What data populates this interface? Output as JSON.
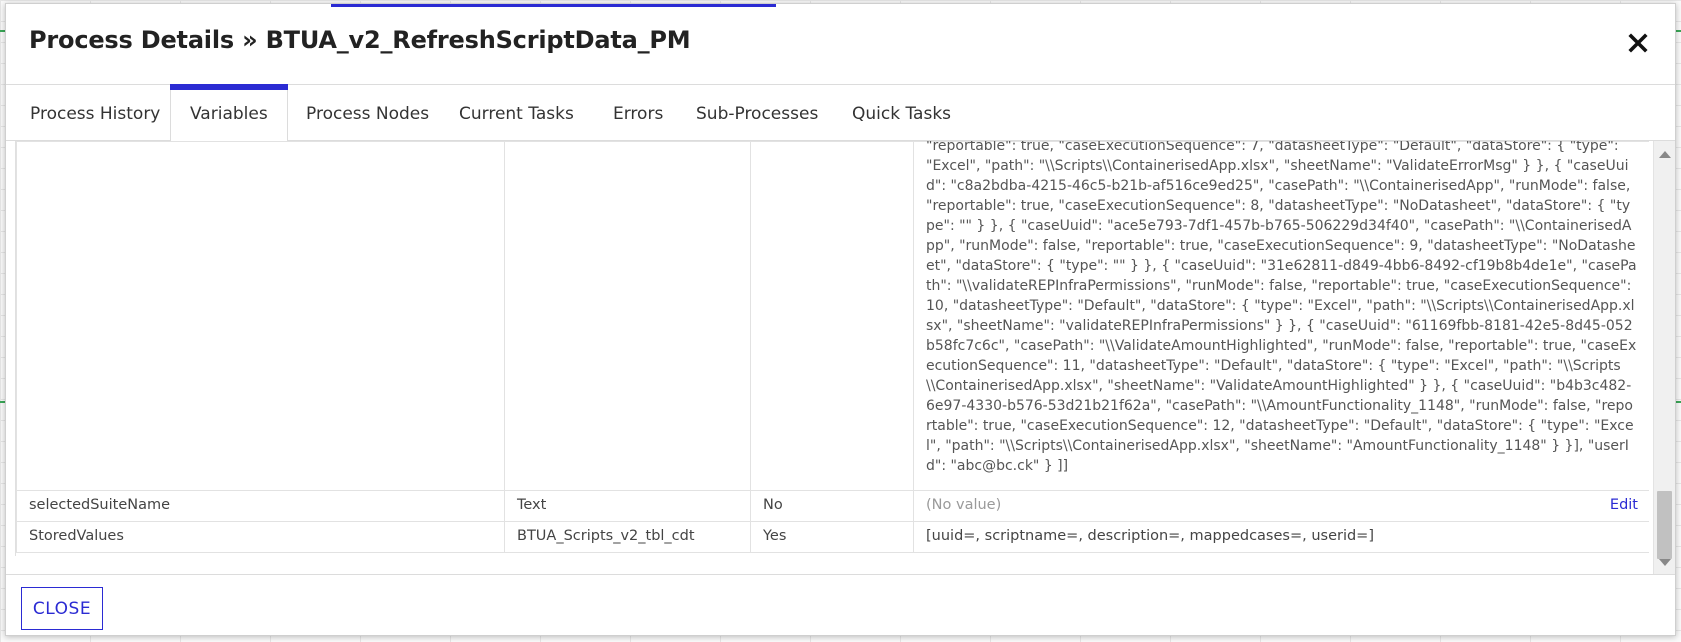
{
  "modal": {
    "title": "Process Details » BTUA_v2_RefreshScriptData_PM",
    "close_icon": "close-icon"
  },
  "tabs": [
    {
      "label": "Process History",
      "active": false
    },
    {
      "label": "Variables",
      "active": true
    },
    {
      "label": "Process Nodes",
      "active": false
    },
    {
      "label": "Current Tasks",
      "active": false
    },
    {
      "label": "Errors",
      "active": false
    },
    {
      "label": "Sub-Processes",
      "active": false
    },
    {
      "label": "Quick Tasks",
      "active": false
    }
  ],
  "variables": {
    "json_row": {
      "name": "",
      "type": "",
      "required": "",
      "value": "\"reportable\": true, \"caseExecutionSequence\": 7, \"datasheetType\": \"Default\", \"dataStore\": { \"type\": \"Excel\", \"path\": \"\\\\Scripts\\\\ContainerisedApp.xlsx\", \"sheetName\": \"ValidateErrorMsg\" } }, { \"caseUuid\": \"c8a2bdba-4215-46c5-b21b-af516ce9ed25\", \"casePath\": \"\\\\ContainerisedApp\", \"runMode\": false, \"reportable\": true, \"caseExecutionSequence\": 8, \"datasheetType\": \"NoDatasheet\", \"dataStore\": { \"type\": \"\" } }, { \"caseUuid\": \"ace5e793-7df1-457b-b765-506229d34f40\", \"casePath\": \"\\\\ContainerisedApp\", \"runMode\": false, \"reportable\": true, \"caseExecutionSequence\": 9, \"datasheetType\": \"NoDatasheet\", \"dataStore\": { \"type\": \"\" } }, { \"caseUuid\": \"31e62811-d849-4bb6-8492-cf19b8b4de1e\", \"casePath\": \"\\\\validateREPInfraPermissions\", \"runMode\": false, \"reportable\": true, \"caseExecutionSequence\": 10, \"datasheetType\": \"Default\", \"dataStore\": { \"type\": \"Excel\", \"path\": \"\\\\Scripts\\\\ContainerisedApp.xlsx\", \"sheetName\": \"validateREPInfraPermissions\" } }, { \"caseUuid\": \"61169fbb-8181-42e5-8d45-052b58fc7c6c\", \"casePath\": \"\\\\ValidateAmountHighlighted\", \"runMode\": false, \"reportable\": true, \"caseExecutionSequence\": 11, \"datasheetType\": \"Default\", \"dataStore\": { \"type\": \"Excel\", \"path\": \"\\\\Scripts\\\\ContainerisedApp.xlsx\", \"sheetName\": \"ValidateAmountHighlighted\" } }, { \"caseUuid\": \"b4b3c482-6e97-4330-b576-53d21b21f62a\", \"casePath\": \"\\\\AmountFunctionality_1148\", \"runMode\": false, \"reportable\": true, \"caseExecutionSequence\": 12, \"datasheetType\": \"Default\", \"dataStore\": { \"type\": \"Excel\", \"path\": \"\\\\Scripts\\\\ContainerisedApp.xlsx\", \"sheetName\": \"AmountFunctionality_1148\" } }], \"userId\": \"abc@bc.ck\" } ]]"
    },
    "rows": [
      {
        "name": "selectedSuiteName",
        "type": "Text",
        "required": "No",
        "value": "(No value)",
        "edit_label": "Edit"
      },
      {
        "name": "StoredValues",
        "type": "BTUA_Scripts_v2_tbl_cdt",
        "required": "Yes",
        "value": "[uuid=, scriptname=, description=, mappedcases=, userid=]"
      }
    ]
  },
  "footer": {
    "close_label": "CLOSE"
  },
  "colors": {
    "accent": "#2b2bd3"
  }
}
